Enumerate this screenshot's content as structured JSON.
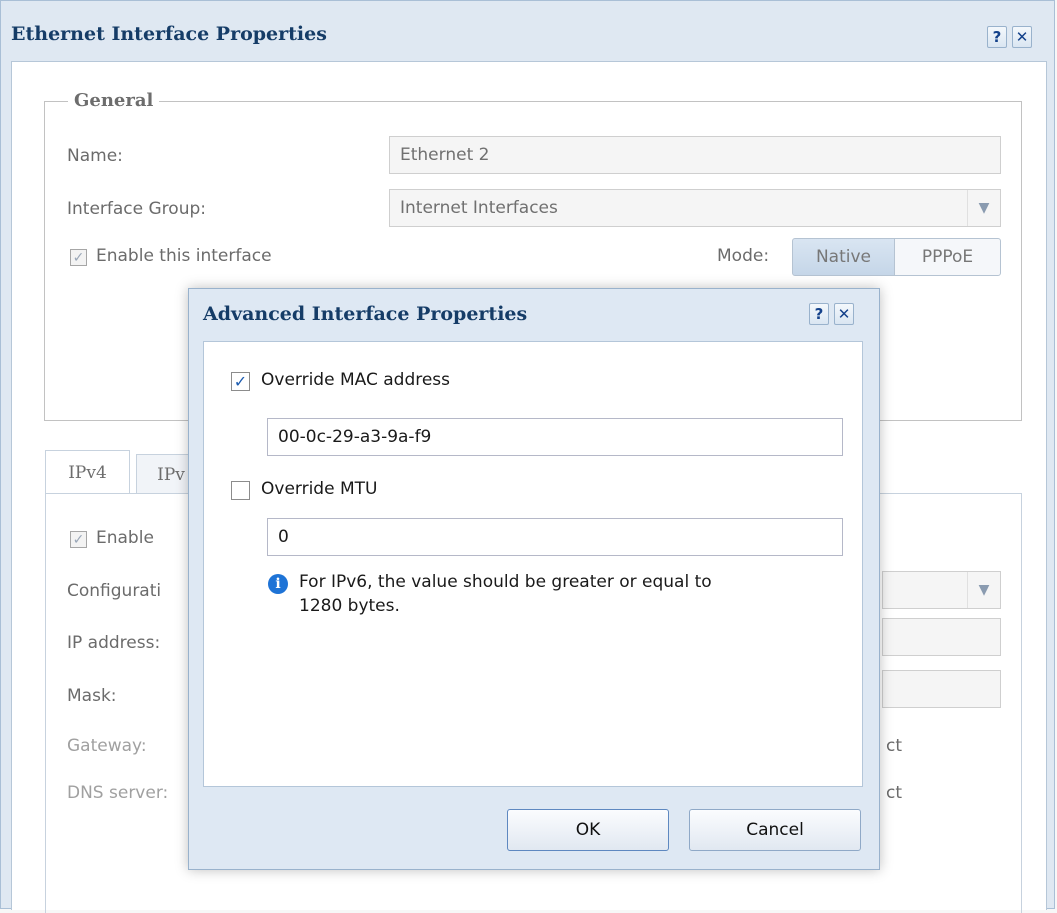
{
  "outer": {
    "title": "Ethernet Interface Properties",
    "help_label": "?",
    "close_label": "✕",
    "general": {
      "legend": "General",
      "name_label": "Name:",
      "name_value": "Ethernet 2",
      "group_label": "Interface Group:",
      "group_value": "Internet Interfaces",
      "enable_label": "Enable this interface",
      "enable_checked": true,
      "mode_label": "Mode:",
      "mode_options": [
        "Native",
        "PPPoE"
      ],
      "mode_selected": "Native"
    },
    "tabs": [
      "IPv4",
      "IPv"
    ],
    "ipv4": {
      "enable_label": "Enable",
      "config_label": "Configurati",
      "ip_label": "IP address:",
      "mask_label": "Mask:",
      "gateway_label": "Gateway:",
      "dns_label": "DNS server:",
      "gateway_tail": "ct",
      "dns_tail": "ct"
    }
  },
  "modal": {
    "title": "Advanced Interface Properties",
    "help_label": "?",
    "close_label": "✕",
    "override_mac_label": "Override MAC address",
    "override_mac_checked": true,
    "mac_value": "00-0c-29-a3-9a-f9",
    "override_mtu_label": "Override MTU",
    "override_mtu_checked": false,
    "mtu_value": "0",
    "info_line1": "For IPv6, the value should be greater or equal to",
    "info_line2": "1280 bytes.",
    "ok_label": "OK",
    "cancel_label": "Cancel"
  },
  "colors": {
    "title": "#153c67",
    "frame": "#dee8f3",
    "info": "#1e73d6",
    "check": "#1d5cb0"
  },
  "icons": {
    "help": "question-icon",
    "close": "close-icon",
    "combo": "chevron-down-icon",
    "info": "info-icon"
  }
}
